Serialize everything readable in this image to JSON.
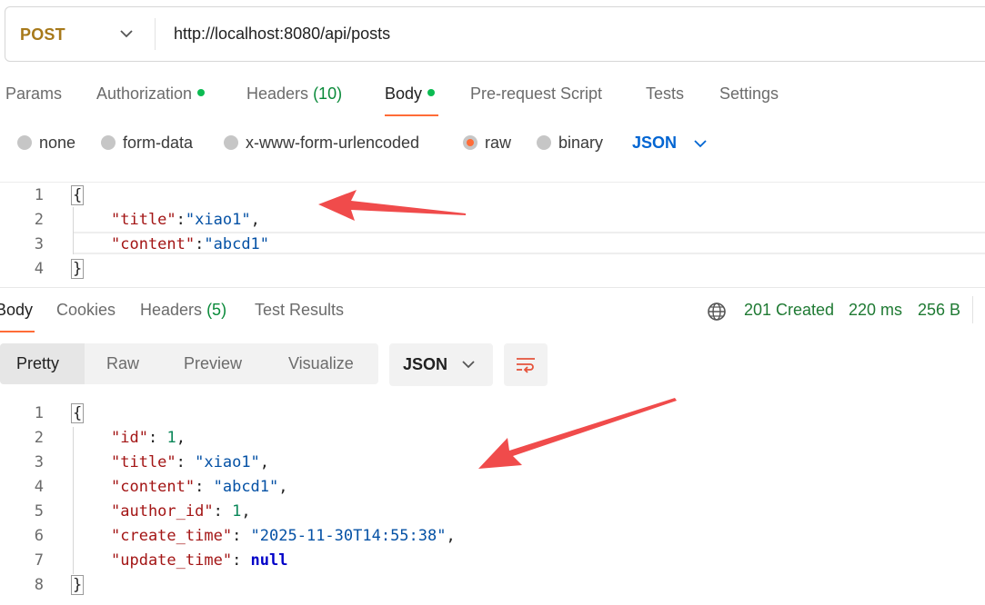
{
  "request": {
    "method": "POST",
    "url": "http://localhost:8080/api/posts"
  },
  "request_tabs": {
    "params": "Params",
    "authorization": "Authorization",
    "headers": "Headers",
    "headers_count": "(10)",
    "body": "Body",
    "pre_request": "Pre-request Script",
    "tests": "Tests",
    "settings": "Settings"
  },
  "body_types": {
    "none": "none",
    "form_data": "form-data",
    "urlencoded": "x-www-form-urlencoded",
    "raw": "raw",
    "binary": "binary",
    "format": "JSON",
    "selected": "raw"
  },
  "request_body": {
    "line_numbers": [
      "1",
      "2",
      "3",
      "4"
    ],
    "open": "{",
    "close": "}",
    "title_key": "\"title\"",
    "title_val": "\"xiao1\"",
    "content_key": "\"content\"",
    "content_val": "\"abcd1\""
  },
  "response_tabs": {
    "body": "Body",
    "cookies": "Cookies",
    "headers": "Headers",
    "headers_count": "(5)",
    "test_results": "Test Results"
  },
  "response_status": {
    "status": "201 Created",
    "time": "220 ms",
    "size": "256 B"
  },
  "view_modes": {
    "pretty": "Pretty",
    "raw": "Raw",
    "preview": "Preview",
    "visualize": "Visualize",
    "format": "JSON"
  },
  "response_body": {
    "line_numbers": [
      "1",
      "2",
      "3",
      "4",
      "5",
      "6",
      "7",
      "8"
    ],
    "open": "{",
    "close": "}",
    "id_key": "\"id\"",
    "id_val": "1",
    "title_key": "\"title\"",
    "title_val": "\"xiao1\"",
    "content_key": "\"content\"",
    "content_val": "\"abcd1\"",
    "author_key": "\"author_id\"",
    "author_val": "1",
    "create_key": "\"create_time\"",
    "create_val": "\"2025-11-30T14:55:38\"",
    "update_key": "\"update_time\"",
    "update_val": "null"
  },
  "icons": {
    "method_dropdown": "chevron-down-icon",
    "format_dropdown": "chevron-down-icon",
    "network": "globe-icon",
    "wrap": "wrap-lines-icon",
    "annotation": "arrow-icon"
  },
  "colors": {
    "accent": "#ff6c37",
    "method": "#a7791a",
    "success": "#1f7a33",
    "link_blue": "#0265d2"
  }
}
